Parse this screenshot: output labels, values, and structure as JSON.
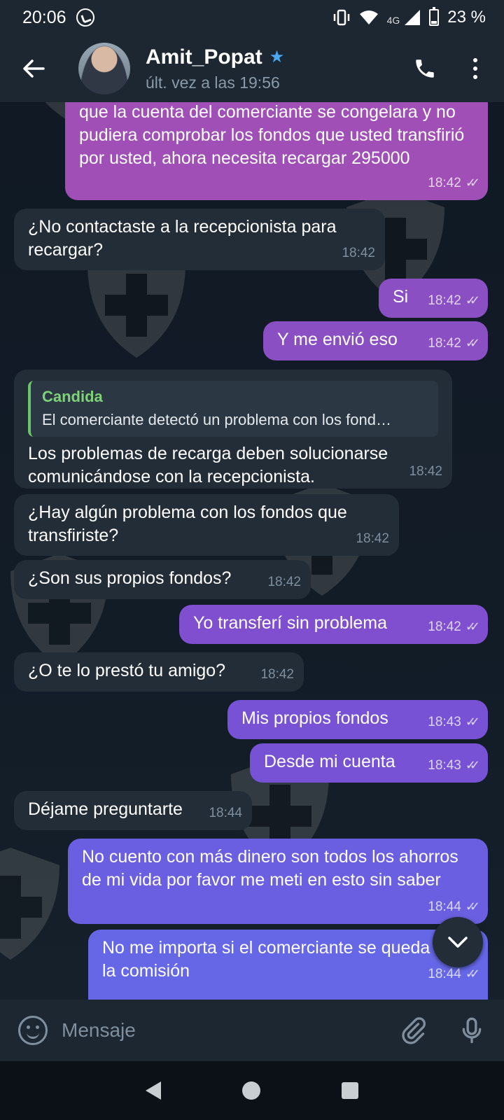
{
  "status_bar": {
    "time": "20:06",
    "network": "4G",
    "battery": "23 %"
  },
  "header": {
    "name": "Amit_Popat",
    "last_seen": "últ. vez a las 19:56"
  },
  "messages": [
    {
      "dir": "out",
      "text": "que la cuenta del comerciante se congelara y no pudiera comprobar los fondos que usted transfirió por usted, ahora necesita recargar 295000",
      "time": "18:42"
    },
    {
      "dir": "in",
      "text": "¿No contactaste a la recepcionista para recargar?",
      "time": "18:42"
    },
    {
      "dir": "out",
      "text": "Si",
      "time": "18:42"
    },
    {
      "dir": "out",
      "text": "Y me envió eso",
      "time": "18:42"
    },
    {
      "dir": "in",
      "reply_name": "Candida",
      "reply_text": "El comerciante detectó un problema con los fond…",
      "text": "Los problemas de recarga deben solucionarse comunicándose con la recepcionista.",
      "time": "18:42"
    },
    {
      "dir": "in",
      "text": "¿Hay algún problema con los fondos que transfiriste?",
      "time": "18:42"
    },
    {
      "dir": "in",
      "text": "¿Son sus propios fondos?",
      "time": "18:42"
    },
    {
      "dir": "out",
      "text": "Yo transferí sin problema",
      "time": "18:42"
    },
    {
      "dir": "in",
      "text": "¿O te lo prestó tu amigo?",
      "time": "18:42"
    },
    {
      "dir": "out",
      "text": "Mis propios fondos",
      "time": "18:43"
    },
    {
      "dir": "out",
      "text": "Desde mi cuenta",
      "time": "18:43"
    },
    {
      "dir": "in",
      "text": "Déjame preguntarte",
      "time": "18:44"
    },
    {
      "dir": "out",
      "text": "No cuento con más dinero son todos los ahorros de mi vida por favor me meti en esto sin saber",
      "time": "18:44"
    },
    {
      "dir": "out",
      "text": "No me importa si el comerciante se queda con la comisión",
      "time": "18:44"
    }
  ],
  "input": {
    "placeholder": "Mensaje"
  },
  "colors": {
    "out_bubble": "#7b52c8",
    "in_bubble": "#222d38",
    "header": "#1d2731",
    "accent_star": "#4aa8f0",
    "reply_name": "#7fd17a"
  },
  "icons": [
    "back-arrow-icon",
    "verified-star-icon",
    "phone-icon",
    "more-vert-icon",
    "emoji-icon",
    "attach-icon",
    "mic-icon",
    "chevron-down-icon",
    "whatsapp-icon"
  ]
}
